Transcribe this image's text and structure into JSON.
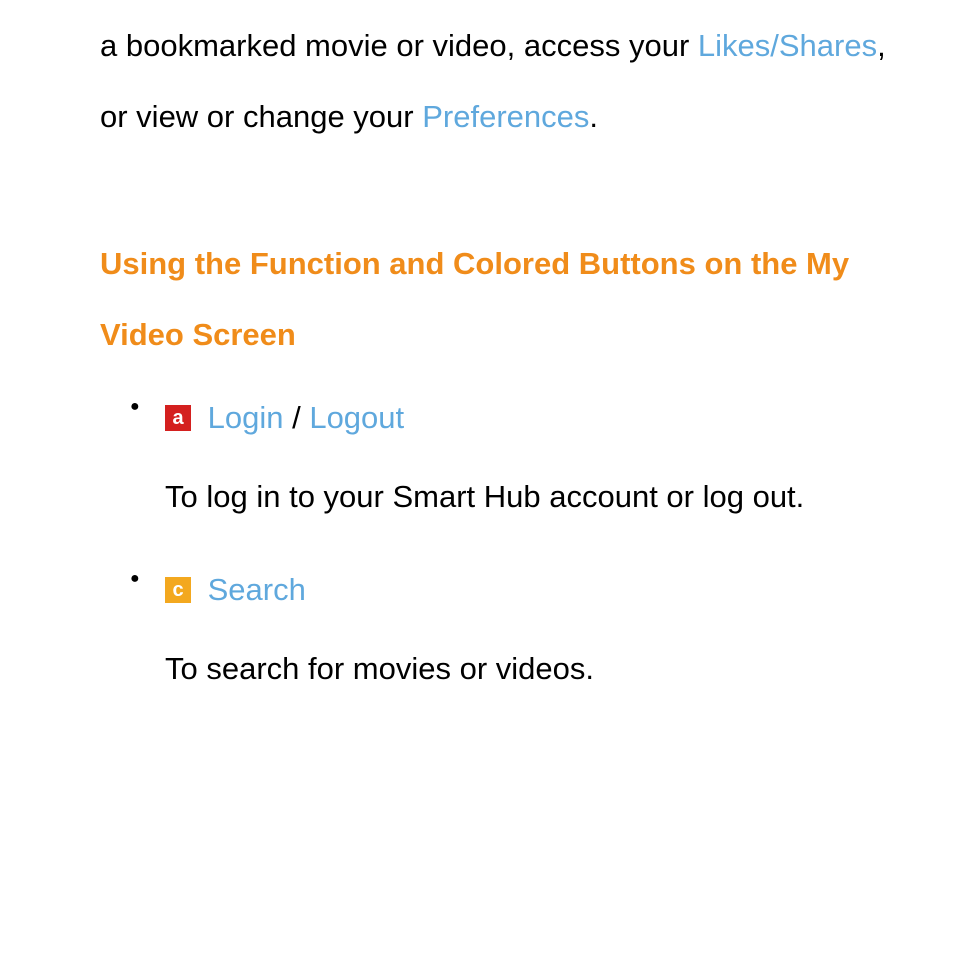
{
  "intro": {
    "text_before_link1": "a bookmarked movie or video, access your ",
    "link1": "Likes/Shares",
    "text_between": ", or view or change your ",
    "link2": "Preferences",
    "text_after": "."
  },
  "section": {
    "heading": "Using the Function and Colored Buttons on the My Video Screen"
  },
  "items": [
    {
      "badge_letter": "a",
      "badge_class": "badge-a",
      "title_parts": {
        "t1": "Login",
        "sep": " / ",
        "t2": "Logout"
      },
      "desc": "To log in to your Smart Hub account or log out."
    },
    {
      "badge_letter": "c",
      "badge_class": "badge-c",
      "title_parts": {
        "t1": "Search",
        "sep": "",
        "t2": ""
      },
      "desc": "To search for movies or videos."
    }
  ]
}
